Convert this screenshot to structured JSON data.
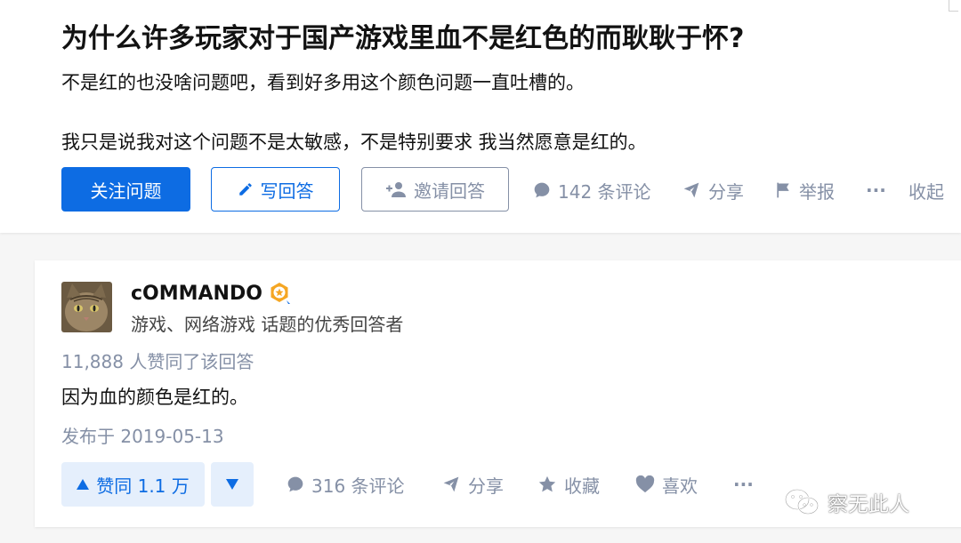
{
  "question": {
    "title": "为什么许多玩家对于国产游戏里血不是红色的而耿耿于怀?",
    "description_line1": "不是红的也没啥问题吧，看到好多用这个颜色问题一直吐槽的。",
    "description_line2": "我只是说我对这个问题不是太敏感，不是特别要求 我当然愿意是红的。",
    "buttons": {
      "follow": "关注问题",
      "write_answer": "写回答",
      "invite": "邀请回答"
    },
    "actions": {
      "comments": "142 条评论",
      "share": "分享",
      "report": "举报",
      "more": "···",
      "collapse": "收起"
    }
  },
  "answer": {
    "author": {
      "name": "cOMMANDO",
      "description": "游戏、网络游戏 话题的优秀回答者"
    },
    "vote_info": "11,888 人赞同了该回答",
    "content": "因为血的颜色是红的。",
    "published": "发布于 2019-05-13",
    "vote_up_label": "赞同 1.1 万",
    "actions": {
      "comments": "316 条评论",
      "share": "分享",
      "collect": "收藏",
      "like": "喜欢",
      "more": "···"
    }
  },
  "watermark": {
    "text": "察无此人"
  },
  "colors": {
    "brand_blue": "#0d6ce3",
    "muted_gray": "#8590a6",
    "vote_bg": "#e5effc",
    "badge_orange": "#f5a623"
  }
}
